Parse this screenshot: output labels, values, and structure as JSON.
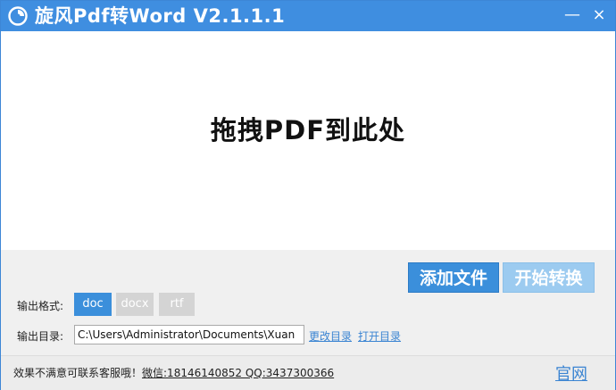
{
  "titlebar": {
    "title": "旋风Pdf转Word  V2.1.1.1",
    "logo_icon": "swirl-logo-icon",
    "minimize_symbol": "—",
    "close_symbol": "×"
  },
  "drop_zone": {
    "text": "拖拽PDF到此处"
  },
  "actions": {
    "add_file_label": "添加文件",
    "start_convert_label": "开始转换"
  },
  "output_format": {
    "label": "输出格式:",
    "options": [
      "doc",
      "docx",
      "rtf"
    ],
    "selected": "doc"
  },
  "output_dir": {
    "label": "输出目录:",
    "value": "C:\\Users\\Administrator\\Documents\\Xuan",
    "change_link": "更改目录",
    "open_link": "打开目录"
  },
  "statusbar": {
    "contact_prefix": "效果不满意可联系客服哦！",
    "contact_info": "微信:18146140852 QQ:3437300366",
    "official_link": "官网"
  },
  "colors": {
    "accent": "#3f8ee0",
    "selected_format": "#3b8fdb",
    "disabled_button": "#9ccbf0",
    "link": "#3a84d2"
  }
}
